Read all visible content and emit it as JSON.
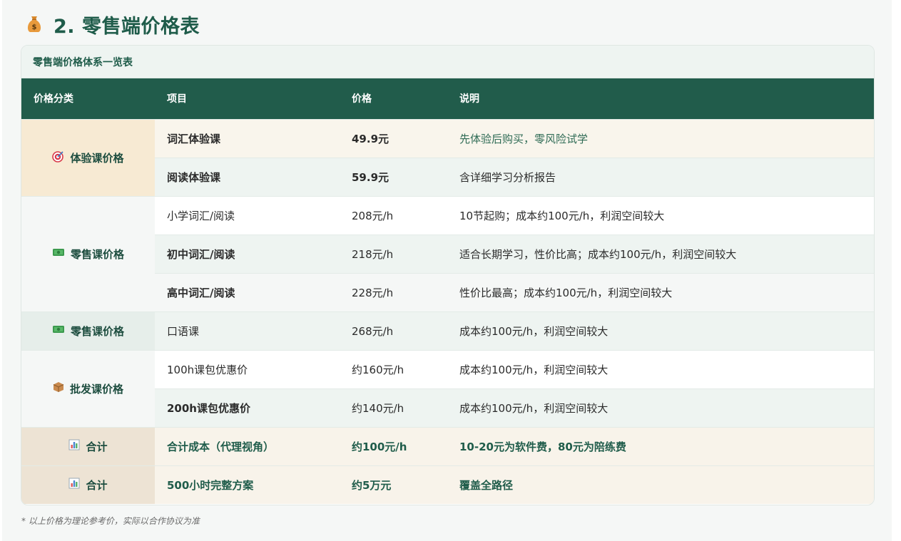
{
  "title": "2. 零售端价格表",
  "table_caption": "零售端价格体系一览表",
  "headers": [
    "价格分类",
    "项目",
    "价格",
    "说明"
  ],
  "categories": {
    "trial": "体验课价格",
    "retail1": "零售课价格",
    "retail2": "零售课价格",
    "wholesale": "批发课价格",
    "total1": "合计",
    "total2": "合计"
  },
  "rows": [
    {
      "item": "词汇体验课",
      "price": "49.9元",
      "note": "先体验后购买，零风险试学"
    },
    {
      "item": "阅读体验课",
      "price": "59.9元",
      "note": "含详细学习分析报告"
    },
    {
      "item": "小学词汇/阅读",
      "price": "208元/h",
      "note": "10节起购；成本约100元/h，利润空间较大"
    },
    {
      "item": "初中词汇/阅读",
      "price": "218元/h",
      "note": "适合长期学习，性价比高；成本约100元/h，利润空间较大"
    },
    {
      "item": "高中词汇/阅读",
      "price": "228元/h",
      "note": "性价比最高；成本约100元/h，利润空间较大"
    },
    {
      "item": "口语课",
      "price": "268元/h",
      "note": "成本约100元/h，利润空间较大"
    },
    {
      "item": "100h课包优惠价",
      "price": "约160元/h",
      "note": "成本约100元/h，利润空间较大"
    },
    {
      "item": "200h课包优惠价",
      "price": "约140元/h",
      "note": "成本约100元/h，利润空间较大"
    },
    {
      "item": "合计成本（代理视角）",
      "price": "约100元/h",
      "note": "10-20元为软件费，80元为陪练费"
    },
    {
      "item": "500小时完整方案",
      "price": "约5万元",
      "note": "覆盖全路径"
    }
  ],
  "footnote": "* 以上价格为理论参考价，实际以合作协议为准",
  "icons": {
    "title": "money-bag-icon",
    "trial": "target-icon",
    "retail": "cash-icon",
    "wholesale": "package-icon",
    "total": "bar-chart-icon"
  },
  "colors": {
    "brand": "#215c4b",
    "accent": "#1f5c4a"
  }
}
